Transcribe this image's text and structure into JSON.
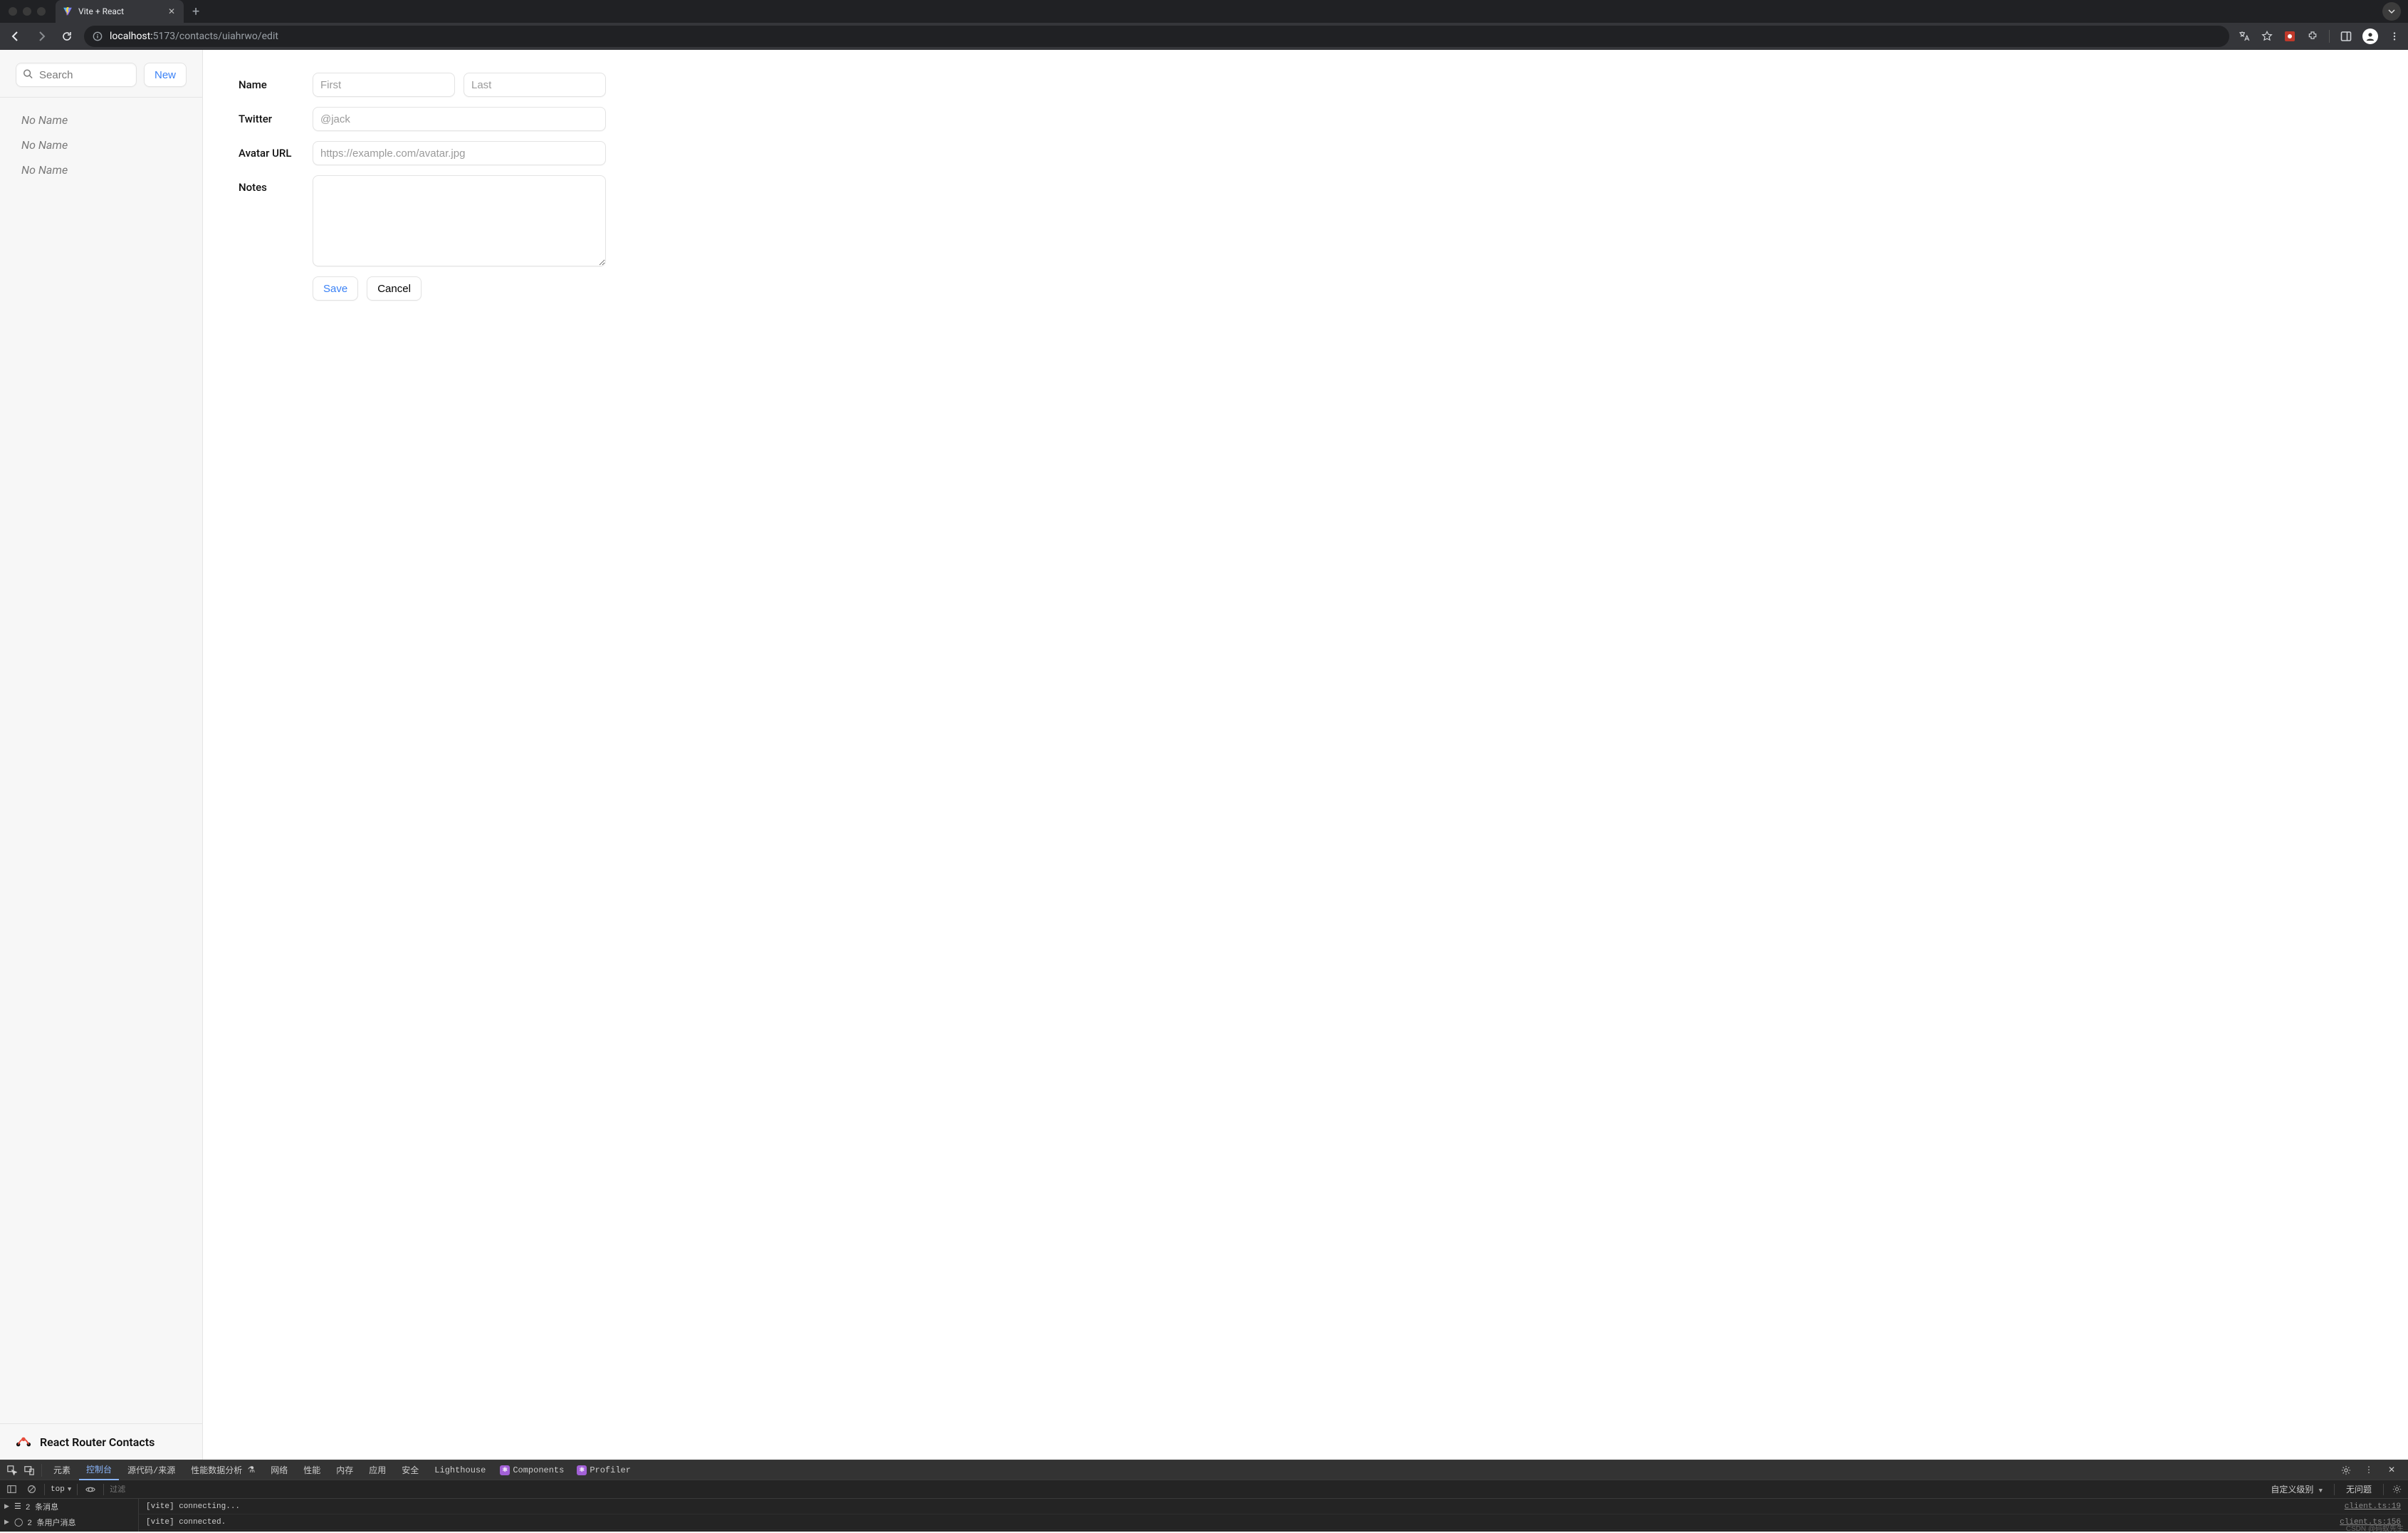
{
  "browser": {
    "tab_title": "Vite + React",
    "url_host": "localhost:",
    "url_port_path": "5173/contacts/uiahrwo/edit"
  },
  "sidebar": {
    "search_placeholder": "Search",
    "new_button": "New",
    "contacts": [
      "No Name",
      "No Name",
      "No Name"
    ],
    "footer": "React Router Contacts"
  },
  "form": {
    "name_label": "Name",
    "first_placeholder": "First",
    "last_placeholder": "Last",
    "twitter_label": "Twitter",
    "twitter_placeholder": "@jack",
    "avatar_label": "Avatar URL",
    "avatar_placeholder": "https://example.com/avatar.jpg",
    "notes_label": "Notes",
    "save_label": "Save",
    "cancel_label": "Cancel"
  },
  "devtools": {
    "tabs": {
      "elements": "元素",
      "console": "控制台",
      "sources": "源代码/来源",
      "performance_insights": "性能数据分析",
      "network": "网络",
      "performance": "性能",
      "memory": "内存",
      "application": "应用",
      "security": "安全",
      "lighthouse": "Lighthouse",
      "components": "Components",
      "profiler": "Profiler"
    },
    "filter": {
      "scope": "top",
      "placeholder": "过滤",
      "custom_levels": "自定义级别",
      "no_issues": "无问题"
    },
    "left": {
      "messages": "2 条消息",
      "user_messages": "2 条用户消息"
    },
    "logs": [
      {
        "text": "[vite] connecting...",
        "src": "client.ts:19"
      },
      {
        "text": "[vite] connected.",
        "src": "client.ts:156"
      }
    ],
    "watermark": "CSDN @码蚁先生"
  }
}
